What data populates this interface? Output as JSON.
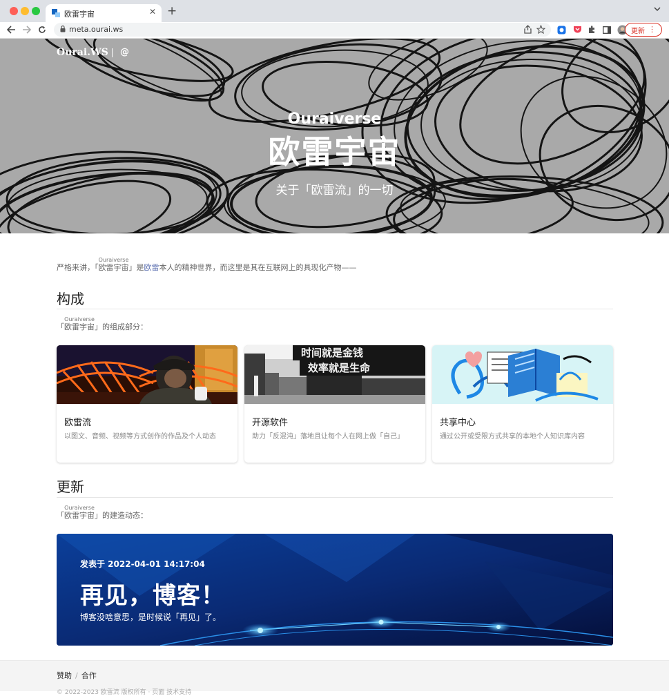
{
  "browser": {
    "tab_title": "欧雷宇宙",
    "url": "meta.ourai.ws",
    "update_label": "更新"
  },
  "hero": {
    "brand": "Ourai.WS",
    "at": "@",
    "subtitle": "Ouraiverse",
    "title": "欧雷宇宙",
    "tagline": "关于「欧雷流」的一切"
  },
  "intro": {
    "prefix": "严格来讲，「",
    "ruby_base": "欧雷宇宙",
    "ruby_text": "Ouraiverse",
    "mid": "」是",
    "link": "欧雷",
    "suffix": "本人的精神世界，而这里是其在互联网上的具现化产物——"
  },
  "composition": {
    "heading": "构成",
    "desc_prefix": "「",
    "ruby_base": "欧雷宇宙",
    "ruby_text": "Ouraiverse",
    "desc_suffix": "」的组成部分：",
    "cards": [
      {
        "title": "欧雷流",
        "text": "以图文、音频、视频等方式创作的作品及个人动态"
      },
      {
        "title": "开源软件",
        "text": "助力「反混沌」落地且让每个人在网上做「自己」"
      },
      {
        "title": "共享中心",
        "text": "通过公开或受限方式共享的本地个人知识库内容"
      }
    ],
    "card2_banner": [
      "时间就是金钱",
      "效率就是生命"
    ]
  },
  "updates": {
    "heading": "更新",
    "desc_prefix": "「",
    "ruby_base": "欧雷宇宙",
    "ruby_text": "Ouraiverse",
    "desc_suffix": "」的建造动态：",
    "post": {
      "date": "发表于 2022-04-01 14:17:04",
      "title": "再见，博客！",
      "desc": "博客没啥意思，是时候说「再见」了。"
    }
  },
  "footer": {
    "links": [
      "赞助",
      "合作"
    ],
    "copyright": "© 2022-2023 欧雷流 版权所有 · 页面 技术支持"
  },
  "colors": {
    "link": "#5b6fb0",
    "update_red": "#d93025",
    "hero_gray": "#a9a9a9",
    "post_blue": "#0a2f7a"
  }
}
